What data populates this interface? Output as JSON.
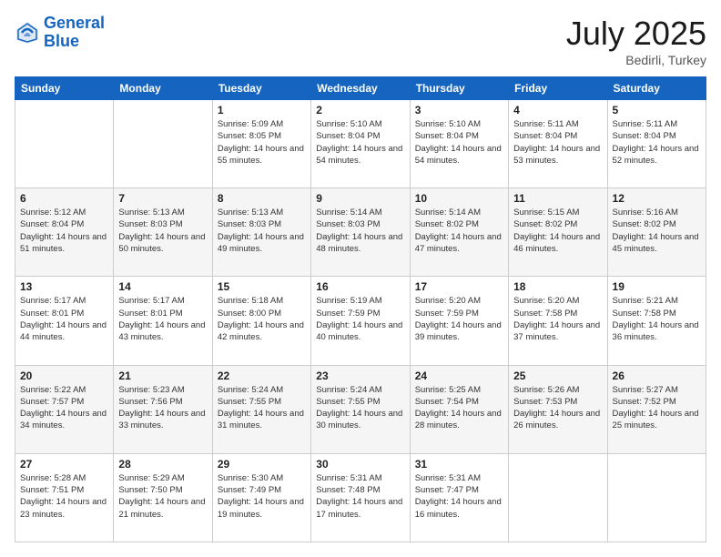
{
  "header": {
    "logo_line1": "General",
    "logo_line2": "Blue",
    "month_title": "July 2025",
    "location": "Bedirli, Turkey"
  },
  "weekdays": [
    "Sunday",
    "Monday",
    "Tuesday",
    "Wednesday",
    "Thursday",
    "Friday",
    "Saturday"
  ],
  "weeks": [
    [
      {
        "day": "",
        "info": ""
      },
      {
        "day": "",
        "info": ""
      },
      {
        "day": "1",
        "info": "Sunrise: 5:09 AM\nSunset: 8:05 PM\nDaylight: 14 hours and 55 minutes."
      },
      {
        "day": "2",
        "info": "Sunrise: 5:10 AM\nSunset: 8:04 PM\nDaylight: 14 hours and 54 minutes."
      },
      {
        "day": "3",
        "info": "Sunrise: 5:10 AM\nSunset: 8:04 PM\nDaylight: 14 hours and 54 minutes."
      },
      {
        "day": "4",
        "info": "Sunrise: 5:11 AM\nSunset: 8:04 PM\nDaylight: 14 hours and 53 minutes."
      },
      {
        "day": "5",
        "info": "Sunrise: 5:11 AM\nSunset: 8:04 PM\nDaylight: 14 hours and 52 minutes."
      }
    ],
    [
      {
        "day": "6",
        "info": "Sunrise: 5:12 AM\nSunset: 8:04 PM\nDaylight: 14 hours and 51 minutes."
      },
      {
        "day": "7",
        "info": "Sunrise: 5:13 AM\nSunset: 8:03 PM\nDaylight: 14 hours and 50 minutes."
      },
      {
        "day": "8",
        "info": "Sunrise: 5:13 AM\nSunset: 8:03 PM\nDaylight: 14 hours and 49 minutes."
      },
      {
        "day": "9",
        "info": "Sunrise: 5:14 AM\nSunset: 8:03 PM\nDaylight: 14 hours and 48 minutes."
      },
      {
        "day": "10",
        "info": "Sunrise: 5:14 AM\nSunset: 8:02 PM\nDaylight: 14 hours and 47 minutes."
      },
      {
        "day": "11",
        "info": "Sunrise: 5:15 AM\nSunset: 8:02 PM\nDaylight: 14 hours and 46 minutes."
      },
      {
        "day": "12",
        "info": "Sunrise: 5:16 AM\nSunset: 8:02 PM\nDaylight: 14 hours and 45 minutes."
      }
    ],
    [
      {
        "day": "13",
        "info": "Sunrise: 5:17 AM\nSunset: 8:01 PM\nDaylight: 14 hours and 44 minutes."
      },
      {
        "day": "14",
        "info": "Sunrise: 5:17 AM\nSunset: 8:01 PM\nDaylight: 14 hours and 43 minutes."
      },
      {
        "day": "15",
        "info": "Sunrise: 5:18 AM\nSunset: 8:00 PM\nDaylight: 14 hours and 42 minutes."
      },
      {
        "day": "16",
        "info": "Sunrise: 5:19 AM\nSunset: 7:59 PM\nDaylight: 14 hours and 40 minutes."
      },
      {
        "day": "17",
        "info": "Sunrise: 5:20 AM\nSunset: 7:59 PM\nDaylight: 14 hours and 39 minutes."
      },
      {
        "day": "18",
        "info": "Sunrise: 5:20 AM\nSunset: 7:58 PM\nDaylight: 14 hours and 37 minutes."
      },
      {
        "day": "19",
        "info": "Sunrise: 5:21 AM\nSunset: 7:58 PM\nDaylight: 14 hours and 36 minutes."
      }
    ],
    [
      {
        "day": "20",
        "info": "Sunrise: 5:22 AM\nSunset: 7:57 PM\nDaylight: 14 hours and 34 minutes."
      },
      {
        "day": "21",
        "info": "Sunrise: 5:23 AM\nSunset: 7:56 PM\nDaylight: 14 hours and 33 minutes."
      },
      {
        "day": "22",
        "info": "Sunrise: 5:24 AM\nSunset: 7:55 PM\nDaylight: 14 hours and 31 minutes."
      },
      {
        "day": "23",
        "info": "Sunrise: 5:24 AM\nSunset: 7:55 PM\nDaylight: 14 hours and 30 minutes."
      },
      {
        "day": "24",
        "info": "Sunrise: 5:25 AM\nSunset: 7:54 PM\nDaylight: 14 hours and 28 minutes."
      },
      {
        "day": "25",
        "info": "Sunrise: 5:26 AM\nSunset: 7:53 PM\nDaylight: 14 hours and 26 minutes."
      },
      {
        "day": "26",
        "info": "Sunrise: 5:27 AM\nSunset: 7:52 PM\nDaylight: 14 hours and 25 minutes."
      }
    ],
    [
      {
        "day": "27",
        "info": "Sunrise: 5:28 AM\nSunset: 7:51 PM\nDaylight: 14 hours and 23 minutes."
      },
      {
        "day": "28",
        "info": "Sunrise: 5:29 AM\nSunset: 7:50 PM\nDaylight: 14 hours and 21 minutes."
      },
      {
        "day": "29",
        "info": "Sunrise: 5:30 AM\nSunset: 7:49 PM\nDaylight: 14 hours and 19 minutes."
      },
      {
        "day": "30",
        "info": "Sunrise: 5:31 AM\nSunset: 7:48 PM\nDaylight: 14 hours and 17 minutes."
      },
      {
        "day": "31",
        "info": "Sunrise: 5:31 AM\nSunset: 7:47 PM\nDaylight: 14 hours and 16 minutes."
      },
      {
        "day": "",
        "info": ""
      },
      {
        "day": "",
        "info": ""
      }
    ]
  ]
}
